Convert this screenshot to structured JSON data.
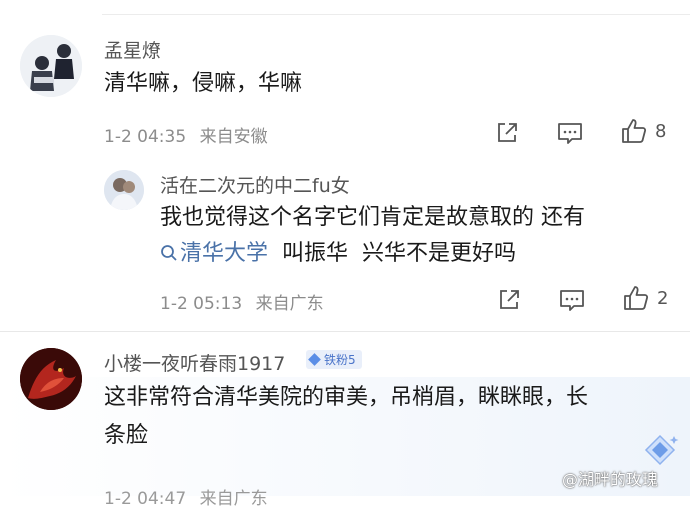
{
  "comments": [
    {
      "username": "孟星燎",
      "text": "清华嘛，侵嘛，华嘛",
      "date": "1-2 04:35",
      "location": "来自安徽",
      "likes": "8"
    },
    {
      "username": "活在二次元的中二fu女",
      "text_line1": "我也觉得这个名字它们肯定是故意取的  还有",
      "topic": "清华大学",
      "text_line2_rest": "  叫振华  兴华不是更好吗",
      "date": "1-2 05:13",
      "location": "来自广东",
      "likes": "2"
    },
    {
      "username": "小楼一夜听春雨1917",
      "badge": "铁粉5",
      "text_line1": "这非常符合清华美院的审美，吊梢眉，眯眯眼，长",
      "text_line2": "条脸",
      "date": "1-2 04:47",
      "location": "来自广东"
    }
  ],
  "watermark": "@湖畔的玫瑰",
  "colors": {
    "topic": "#4a72a8",
    "meta": "#8c8c8c",
    "badge_bg": "#e9effa",
    "badge_fg": "#4a74c9"
  },
  "icons": {
    "share": "share-icon",
    "comment": "comment-icon",
    "like": "thumbs-up-icon",
    "search": "search-icon"
  }
}
